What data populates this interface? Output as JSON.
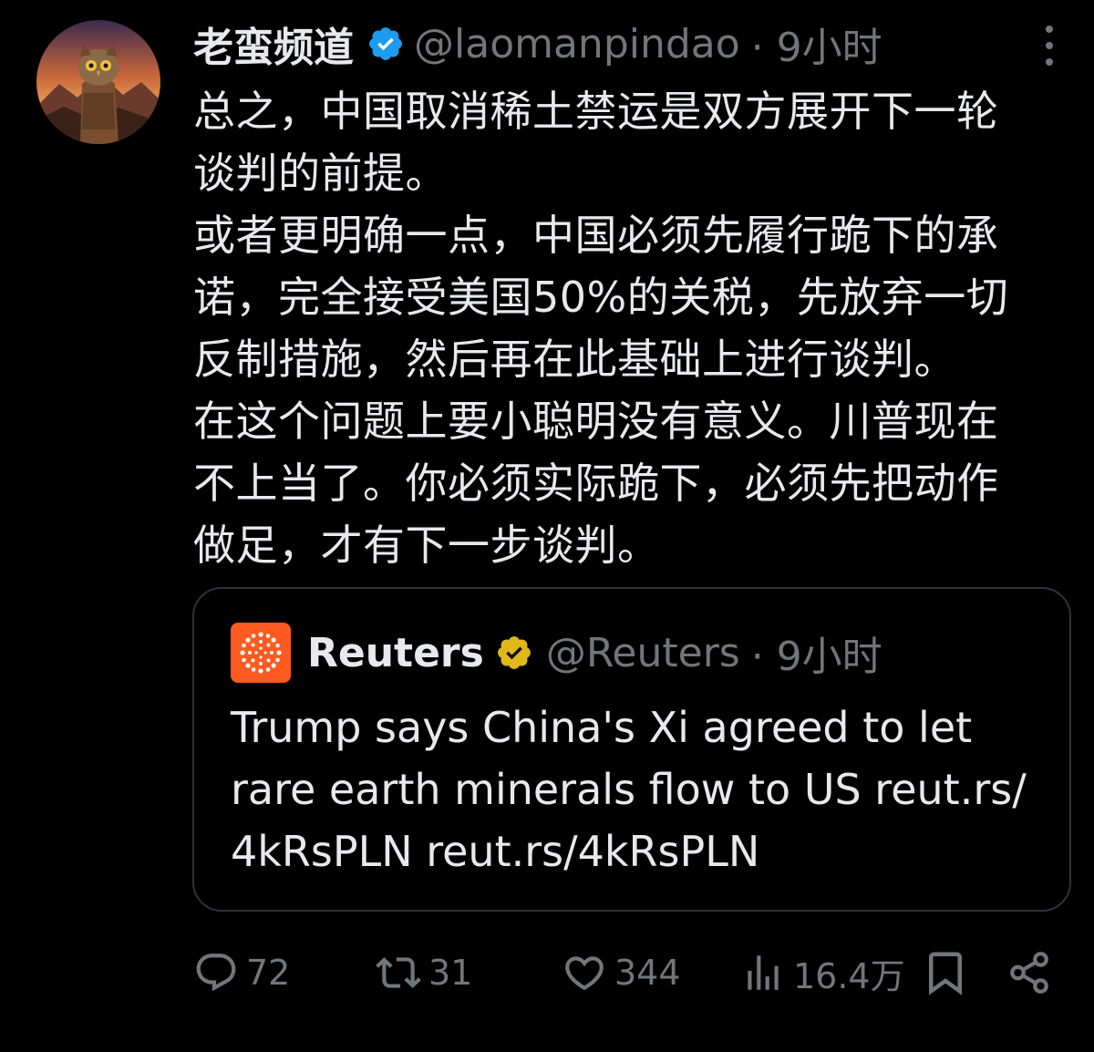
{
  "tweet": {
    "author": {
      "display_name": "老蛮频道",
      "handle": "@laomanpindao",
      "time": "· 9小时",
      "verified": true,
      "avatar": "owl-avatar"
    },
    "text_lines": [
      "总之，中国取消稀土禁运是双方展开下一轮",
      "谈判的前提。",
      "或者更明确一点，中国必须先履行跪下的承",
      "诺，完全接受美国50%的关税，先放弃一切",
      "反制措施，然后再在此基础上进行谈判。",
      "在这个问题上要小聪明没有意义。川普现在",
      "不上当了。你必须实际跪下，必须先把动作",
      "做足，才有下一步谈判。"
    ]
  },
  "quote": {
    "display_name": "Reuters",
    "handle": "@Reuters",
    "time": "· 9小时",
    "verified_gold": true,
    "text_lines": [
      "Trump says China's Xi agreed to let",
      "rare earth minerals flow to US reut.rs/",
      "4kRsPLN reut.rs/4kRsPLN"
    ]
  },
  "actions": {
    "replies": "72",
    "reposts": "31",
    "likes": "344",
    "views": "16.4万"
  },
  "colors": {
    "background": "#000000",
    "text": "#e7e9ea",
    "muted": "#71767b",
    "verified_blue": "#1d9bf0",
    "verified_gold": "#e2b719",
    "reuters_orange": "#ff5a1f",
    "border": "#2f3336"
  }
}
